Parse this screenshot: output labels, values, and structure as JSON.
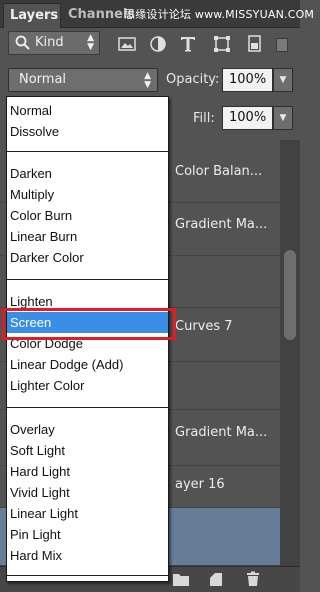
{
  "tabs": [
    {
      "label": "Layers",
      "active": true
    },
    {
      "label": "Channels",
      "active": false
    }
  ],
  "watermark": "思缘设计论坛 www.MISSYUAN.COM",
  "filter": {
    "kind_label": "Kind",
    "icons": [
      "pixel-filter-icon",
      "adjustment-filter-icon",
      "type-filter-icon",
      "shape-filter-icon",
      "smart-object-filter-icon"
    ]
  },
  "blend_mode": {
    "current": "Normal",
    "opacity_label": "Opacity:",
    "opacity_value": "100%",
    "fill_label": "Fill:",
    "fill_value": "100%"
  },
  "layers": [
    {
      "name": "Color Balan..."
    },
    {
      "name": "Gradient Ma..."
    },
    {
      "name": ""
    },
    {
      "name": "Curves 7"
    },
    {
      "name": ""
    },
    {
      "name": "Gradient Ma..."
    },
    {
      "name": "ayer 16"
    },
    {
      "name": "",
      "selected": true
    }
  ],
  "blend_menu": {
    "groups": [
      [
        "Normal",
        "Dissolve"
      ],
      [
        "Darken",
        "Multiply",
        "Color Burn",
        "Linear Burn",
        "Darker Color"
      ],
      [
        "Lighten",
        "Screen",
        "Color Dodge",
        "Linear Dodge (Add)",
        "Lighter Color"
      ],
      [
        "Overlay",
        "Soft Light",
        "Hard Light",
        "Vivid Light",
        "Linear Light",
        "Pin Light",
        "Hard Mix"
      ]
    ],
    "selected_item": "Screen",
    "highlight_color": "#3b8ee6",
    "annotation_color": "#e01b24"
  },
  "bottom_icons": [
    "new-group-folder-icon",
    "new-layer-icon",
    "trash-icon"
  ]
}
